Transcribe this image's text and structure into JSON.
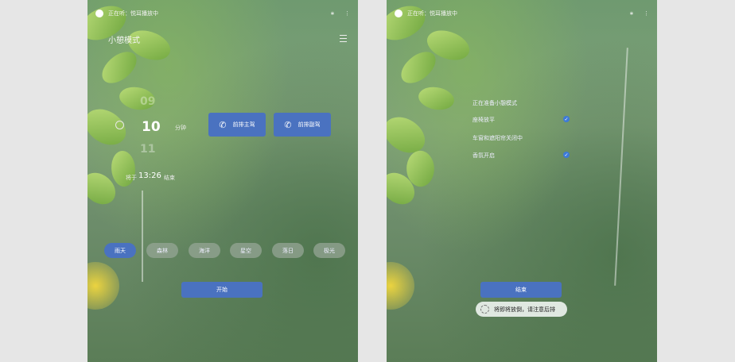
{
  "left_screen": {
    "status_text": "正在听：悦耳播放中",
    "title": "小憩模式",
    "ghost_above": "09",
    "duration_value": "10",
    "duration_unit": "分钟",
    "ghost_below": "11",
    "end_label": "将于",
    "end_time": "13:26",
    "end_suffix": "结束",
    "call_buttons": [
      "前排主驾",
      "前排副驾"
    ],
    "chips": [
      {
        "label": "雨天",
        "active": true
      },
      {
        "label": "森林",
        "active": false
      },
      {
        "label": "海洋",
        "active": false
      },
      {
        "label": "星空",
        "active": false
      },
      {
        "label": "落日",
        "active": false
      },
      {
        "label": "极光",
        "active": false
      }
    ],
    "start_button": "开始"
  },
  "right_screen": {
    "status_text": "正在听：悦耳播放中",
    "heading": "正在准备小憩模式",
    "items": [
      {
        "label": "座椅放平",
        "checked": true
      },
      {
        "label": "车窗和遮阳帘关闭中",
        "checked": false
      },
      {
        "label": "香氛开启",
        "checked": true
      }
    ],
    "end_button": "结束",
    "toast": "将即将放倒，请注意后排"
  },
  "colors": {
    "accent": "#4a72c0",
    "check": "#3d7ad8",
    "background": "#e6e6e6"
  },
  "icons": [
    "phone-icon",
    "clock-icon",
    "menu-icon",
    "spinner-icon",
    "check-icon"
  ]
}
